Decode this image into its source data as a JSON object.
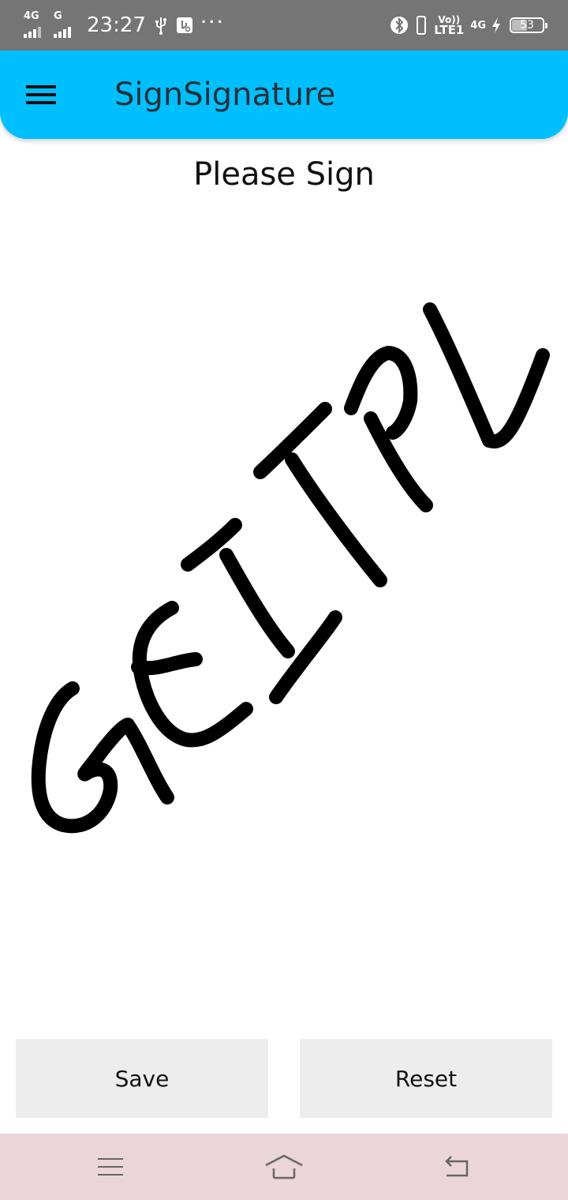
{
  "status_bar": {
    "network1": "4G",
    "network2": "G",
    "time": "23:27",
    "volte_top": "Vo))",
    "volte_bottom": "LTE1",
    "network4g": "4G",
    "battery_percent": "53",
    "battery_level": 0.53,
    "icons": [
      "usb-icon",
      "usb-debugging-icon",
      "more-notifications-icon",
      "bluetooth-icon",
      "phone-icon",
      "charging-icon"
    ]
  },
  "app_bar": {
    "title": "SignSignature",
    "menu_icon": "hamburger-menu-icon",
    "background": "#00bfff"
  },
  "content": {
    "prompt": "Please Sign",
    "signature_text": "GEITPL"
  },
  "actions": {
    "save_label": "Save",
    "reset_label": "Reset"
  },
  "nav_bar": {
    "icons": [
      "menu-icon",
      "home-icon",
      "back-icon"
    ],
    "background": "#ebd5d8"
  }
}
